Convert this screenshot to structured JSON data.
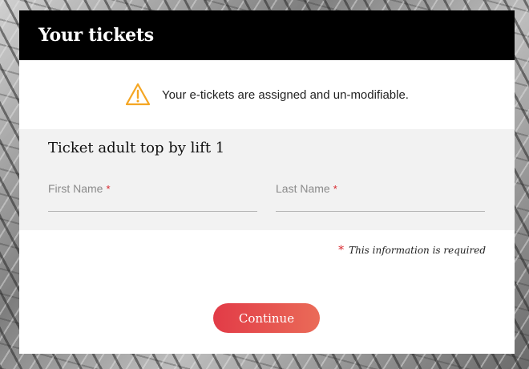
{
  "modal": {
    "title": "Your tickets",
    "notice": {
      "icon": "warning-triangle-icon",
      "icon_color": "#f5a623",
      "text": "Your e-tickets are assigned and un-modifiable."
    },
    "ticket": {
      "title": "Ticket adult top by lift 1",
      "fields": {
        "first_name_label": "First Name",
        "last_name_label": "Last Name",
        "required_marker": "*"
      }
    },
    "required_note": {
      "marker": "*",
      "text": "This information is required"
    },
    "continue_label": "Continue"
  },
  "colors": {
    "header_bg": "#000000",
    "section_bg": "#f2f2f2",
    "required": "#d8262c",
    "button_start": "#e23b47",
    "button_end": "#ea6b58"
  }
}
